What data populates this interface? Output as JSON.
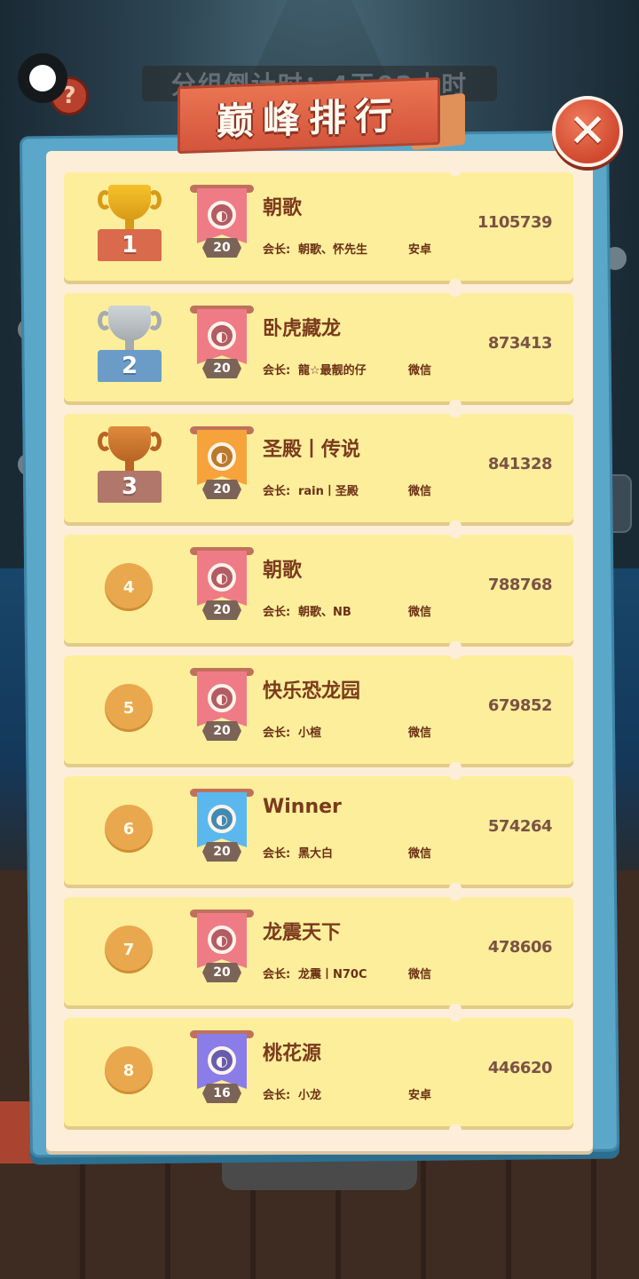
{
  "header": {
    "title": "巅峰排行",
    "countdown": "分组倒计时：4天02小时",
    "help_glyph": "?",
    "close_glyph": "✕"
  },
  "labels": {
    "leader_prefix": "会长:"
  },
  "colors": {
    "gold": "#f6c12b",
    "silver": "#cfd4d8",
    "bronze": "#e08a3c",
    "banner_pink": "#ef7b86",
    "banner_orange": "#f7a33b",
    "banner_blue": "#5ab8ee",
    "banner_purple": "#8a7de8"
  },
  "rankings": [
    {
      "rank": "1",
      "name": "朝歌",
      "leader": "朝歌、怀先生",
      "platform": "安卓",
      "score": "1105739",
      "level": "20",
      "banner": "pink",
      "emblem": "moon-emblem-icon"
    },
    {
      "rank": "2",
      "name": "卧虎藏龙",
      "leader": "龍☆最靓的仔",
      "platform": "微信",
      "score": "873413",
      "level": "20",
      "banner": "pink",
      "emblem": "bird-emblem-icon"
    },
    {
      "rank": "3",
      "name": "圣殿丨传说",
      "leader": "rain丨圣殿",
      "platform": "微信",
      "score": "841328",
      "level": "20",
      "banner": "orange",
      "emblem": "moon-emblem-icon"
    },
    {
      "rank": "4",
      "name": "朝歌",
      "leader": "朝歌、NB",
      "platform": "微信",
      "score": "788768",
      "level": "20",
      "banner": "pink",
      "emblem": "moon-emblem-icon"
    },
    {
      "rank": "5",
      "name": "快乐恐龙园",
      "leader": "小楦",
      "platform": "微信",
      "score": "679852",
      "level": "20",
      "banner": "pink",
      "emblem": "moon-emblem-icon"
    },
    {
      "rank": "6",
      "name": "Winner",
      "leader": "黑大白",
      "platform": "微信",
      "score": "574264",
      "level": "20",
      "banner": "blue",
      "emblem": "moon-emblem-icon"
    },
    {
      "rank": "7",
      "name": "龙震天下",
      "leader": "龙震丨N70C",
      "platform": "微信",
      "score": "478606",
      "level": "20",
      "banner": "pink",
      "emblem": "dragon-emblem-icon"
    },
    {
      "rank": "8",
      "name": "桃花源",
      "leader": "小龙",
      "platform": "安卓",
      "score": "446620",
      "level": "16",
      "banner": "purple",
      "emblem": "moon-emblem-icon"
    }
  ]
}
